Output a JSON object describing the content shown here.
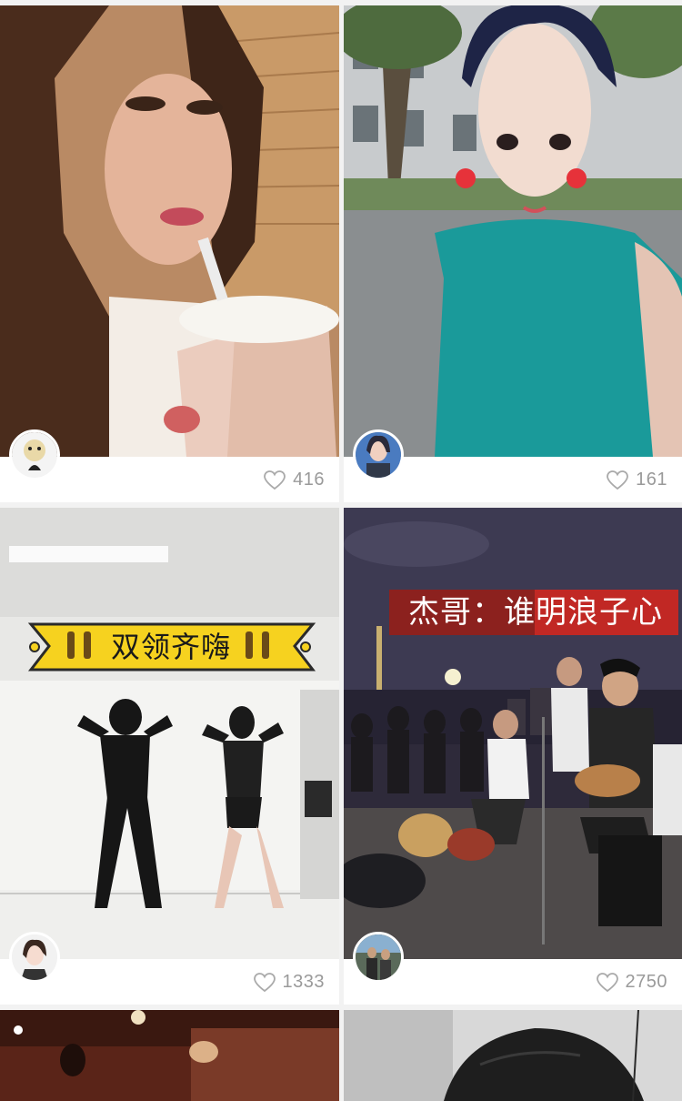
{
  "feed": {
    "cards": [
      {
        "likes": "416",
        "avatar": "avatar"
      },
      {
        "likes": "161",
        "avatar": "avatar"
      },
      {
        "likes": "1333",
        "avatar": "avatar",
        "caption": "双领齐嗨"
      },
      {
        "likes": "2750",
        "avatar": "avatar",
        "caption": "杰哥：谁明浪子心"
      }
    ]
  },
  "icons": {
    "like": "heart-outline-icon"
  },
  "colors": {
    "like_text": "#9a9a9a",
    "banner_yellow": "#f6d21f",
    "banner_red": "#d8261c"
  }
}
